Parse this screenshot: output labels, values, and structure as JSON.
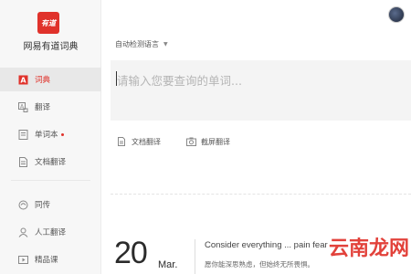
{
  "app": {
    "logo_text": "有道",
    "name": "网易有道词典"
  },
  "nav": [
    {
      "label": "词典",
      "active": true
    },
    {
      "label": "翻译"
    },
    {
      "label": "单词本",
      "dot": true
    },
    {
      "label": "文档翻译"
    }
  ],
  "nav2": [
    {
      "label": "同传"
    },
    {
      "label": "人工翻译"
    },
    {
      "label": "精品课"
    }
  ],
  "search": {
    "language": "自动检测语言",
    "placeholder": "请输入您要查询的单词..."
  },
  "tools": {
    "doc": "文档翻译",
    "screen": "截屏翻译"
  },
  "daily": {
    "day": "20",
    "month": "Mar.",
    "quote_en": "Consider everything ... pain fear",
    "quote_zh": "愿你能深思熟虑，但始终无所畏惧。"
  },
  "watermark": "云南龙网",
  "colors": {
    "brand": "#e0322b",
    "sidebar_bg": "#f7f7f7",
    "input_bg": "#f4f4f4"
  }
}
